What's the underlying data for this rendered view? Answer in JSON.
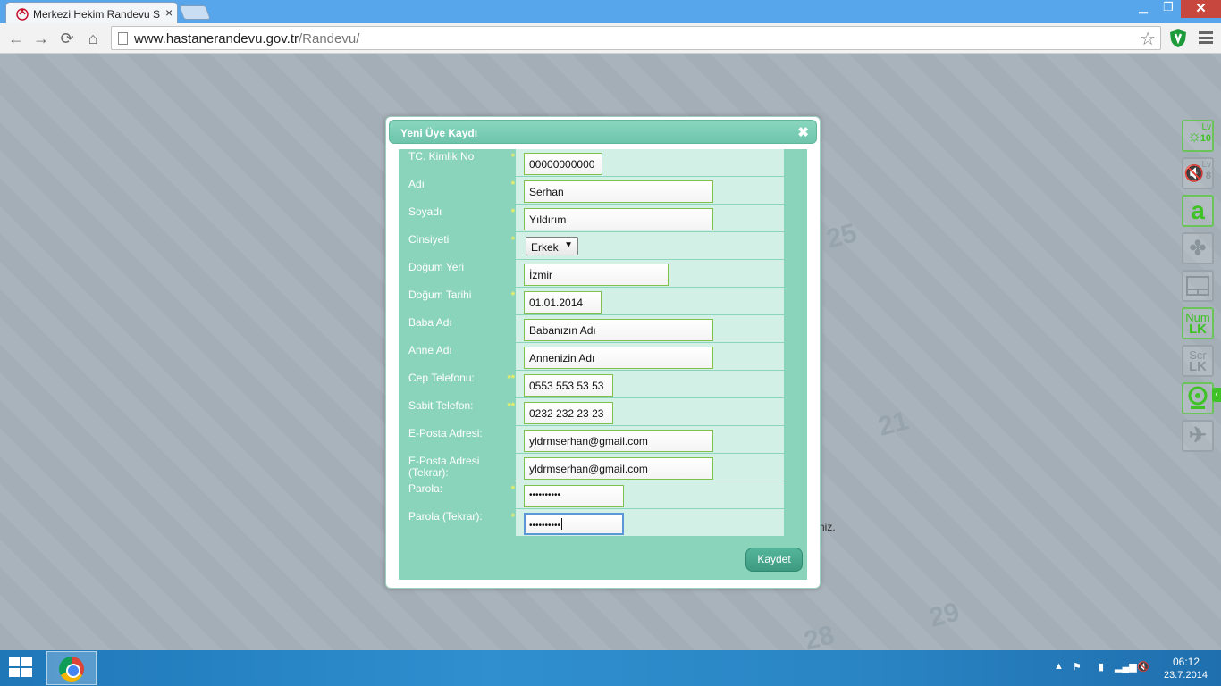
{
  "browser": {
    "tab_title": "Merkezi Hekim Randevu Sistemi",
    "url_host": "www.hastanerandevu.gov.tr",
    "url_path": "/Randevu/"
  },
  "page": {
    "background_text_fragment": "niz."
  },
  "modal": {
    "title": "Yeni Üye Kaydı",
    "close_label": "✖",
    "fields": [
      {
        "label": "TC. Kimlik No",
        "required": "*",
        "value": "00000000000"
      },
      {
        "label": "Adı",
        "required": "*",
        "value": "Serhan"
      },
      {
        "label": "Soyadı",
        "required": "*",
        "value": "Yıldırım"
      },
      {
        "label": "Cinsiyeti",
        "required": "*",
        "value": "Erkek"
      },
      {
        "label": "Doğum Yeri",
        "required": "",
        "value": "İzmir"
      },
      {
        "label": "Doğum Tarihi",
        "required": "*",
        "value": "01.01.2014"
      },
      {
        "label": "Baba Adı",
        "required": "",
        "value": "Babanızın Adı"
      },
      {
        "label": "Anne Adı",
        "required": "",
        "value": "Annenizin Adı"
      },
      {
        "label": "Cep Telefonu:",
        "required": "**",
        "value": "0553 553 53 53"
      },
      {
        "label": "Sabit Telefon:",
        "required": "**",
        "value": "0232 232 23 23"
      },
      {
        "label": "E-Posta Adresi:",
        "required": "",
        "value": "yldrmserhan@gmail.com"
      },
      {
        "label": "E-Posta Adresi (Tekrar):",
        "required": "",
        "value": "yldrmserhan@gmail.com"
      },
      {
        "label": "Parola:",
        "required": "*",
        "value": "••••••••••"
      },
      {
        "label": "Parola (Tekrar):",
        "required": "*",
        "value": "••••••••••"
      }
    ],
    "save_label": "Kaydet"
  },
  "side_widgets": {
    "brightness_level": "Lv\n10",
    "volume_level": "Lv\n8",
    "amazon_letter": "a",
    "numlock_top": "Num",
    "numlock_bottom": "LK",
    "scrlock_top": "Scr",
    "scrlock_bottom": "LK"
  },
  "taskbar": {
    "time": "06:12",
    "date": "23.7.2014"
  },
  "colors": {
    "modal_header": "#6ec5ab",
    "form_label_bg": "#8bd4bc",
    "form_cell_bg": "#d2f0e6",
    "required_mark": "#f0f060",
    "input_border": "#7fc04f",
    "focus_border": "#5b97d6",
    "taskbar": "#2f8fcf",
    "titlebar": "#57a6ec"
  }
}
